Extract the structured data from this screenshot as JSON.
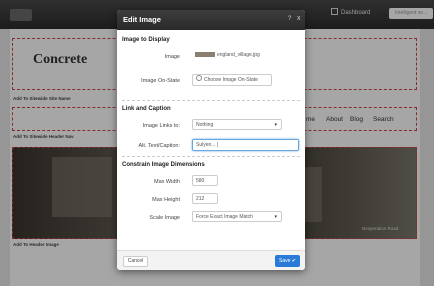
{
  "topbar": {
    "dashboard_label": "Dashboard",
    "search_placeholder": "Intelligent se..."
  },
  "page": {
    "site_name": "Concrete",
    "area_site_name": "Add To Sitewide Site Name",
    "area_header_nav": "Add To Sitewide Header Nav",
    "area_header_image": "Add To Header Image",
    "nav": [
      "me",
      "About",
      "Blog",
      "Search"
    ],
    "photo_caption": "Desperation Road"
  },
  "dialog": {
    "title": "Edit Image",
    "help_label": "?",
    "close_label": "x",
    "section_display": "Image to Display",
    "image_label": "Image",
    "image_value": "england_village.jpg",
    "onstate_label": "Image On-State",
    "onstate_value": "Choose Image On-State",
    "section_link": "Link and Caption",
    "links_label": "Image Links to:",
    "links_value": "Nothing",
    "alt_label": "Alt. Text/Caption:",
    "alt_value": "Sulyen... |",
    "section_dims": "Constrain Image Dimensions",
    "maxwidth_label": "Max Width",
    "maxwidth_value": "580",
    "maxheight_label": "Max Height",
    "maxheight_value": "212",
    "scale_label": "Scale Image",
    "scale_value": "Force Exact Image Match",
    "cancel_label": "Cancel",
    "save_label": "Save"
  }
}
